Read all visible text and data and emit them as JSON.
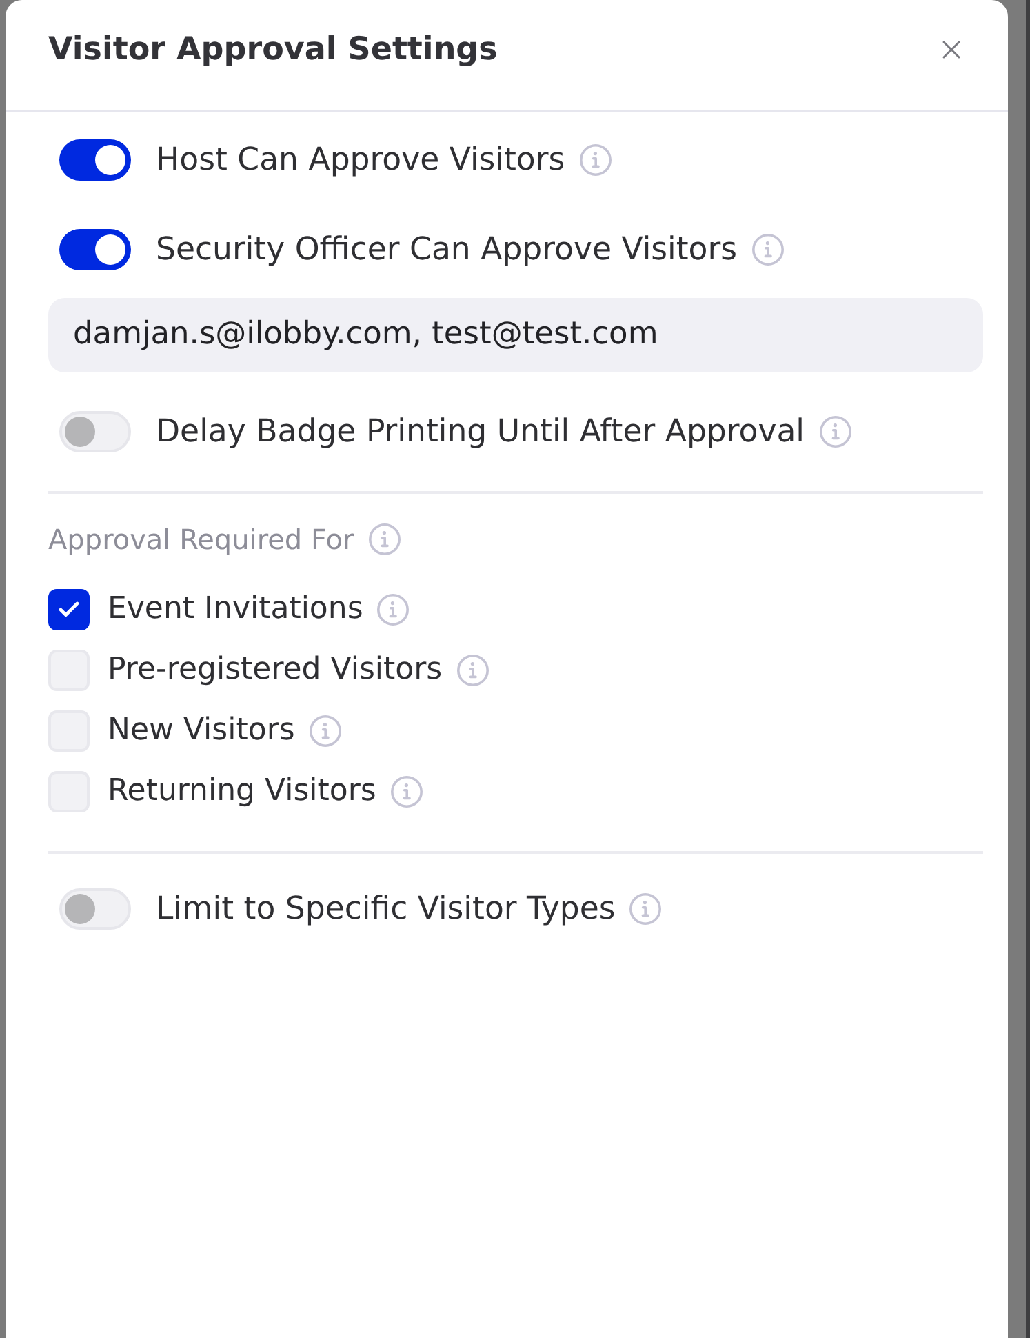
{
  "dialog": {
    "title": "Visitor Approval Settings"
  },
  "approval_settings": [
    {
      "kind": "toggle",
      "label": "Host Can Approve Visitors",
      "on": true
    },
    {
      "kind": "toggle",
      "label": "Security Officer Can Approve Visitors",
      "on": true
    },
    {
      "kind": "field",
      "value": "damjan.s@ilobby.com, test@test.com"
    },
    {
      "kind": "toggle",
      "label": "Delay Badge Printing Until After Approval",
      "on": false
    }
  ],
  "approval_required_for": {
    "heading": "Approval Required For",
    "options": [
      {
        "label": "Event Invitations",
        "checked": true
      },
      {
        "label": "Pre-registered Visitors",
        "checked": false
      },
      {
        "label": "New Visitors",
        "checked": false
      },
      {
        "label": "Returning Visitors",
        "checked": false
      }
    ]
  },
  "visitor_type_limit": {
    "label": "Limit to Specific Visitor Types",
    "on": false
  }
}
